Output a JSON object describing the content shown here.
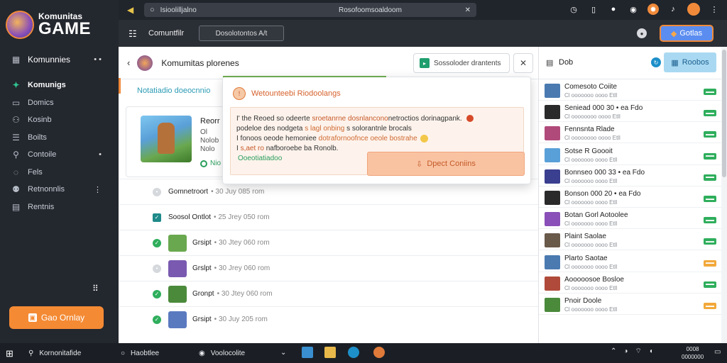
{
  "sidebar": {
    "logo_small": "Komunitas",
    "logo_big": "GAME",
    "main_item": "Komunnies",
    "items": [
      {
        "label": "Komunigs",
        "icon": "gamepad-icon"
      },
      {
        "label": "Domics",
        "icon": "chat-icon"
      },
      {
        "label": "Kosinb",
        "icon": "group-icon"
      },
      {
        "label": "Boilts",
        "icon": "list-icon"
      },
      {
        "label": "Contoile",
        "icon": "search-icon"
      },
      {
        "label": "Fels",
        "icon": "chat-icon"
      },
      {
        "label": "Retnonnlis",
        "icon": "users-icon"
      },
      {
        "label": "Rentnis",
        "icon": "building-icon"
      }
    ],
    "cta_label": "Gao Ornlay"
  },
  "topbar": {
    "url_left": "Isioolilljalno",
    "url_mid": "Rosofoomsoaldoom",
    "pin": "✕"
  },
  "toolbar": {
    "title": "Comuntfilr",
    "box_label": "Dosolotontos A/t",
    "button_label": "Gotlas"
  },
  "main": {
    "header_title": "Komumitas plorenes",
    "filter_label": "Sossoloder drantents",
    "section_title": "Notatiadio doeocnnio",
    "card": {
      "title": "Reorr",
      "line1": "Ol",
      "line2": "Nolob",
      "line3": "Nolo",
      "status": "Nio"
    },
    "rows": [
      {
        "name": "Gomnetroort",
        "meta": "• 30 Juy 085 rom",
        "check": "grey",
        "thumb": null
      },
      {
        "name": "Soosol Ontlot",
        "meta": "• 25 Jrey 050 rom",
        "check": "box",
        "thumb": null
      },
      {
        "name": "Grsipt",
        "meta": "• 30 Jtey 060 rom",
        "check": "green",
        "thumb": "#6aa84f"
      },
      {
        "name": "Grslpt",
        "meta": "• 30 Jrey 060 rom",
        "check": "grey",
        "thumb": "#7a5ab0"
      },
      {
        "name": "Gronpt",
        "meta": "• 30 Jtey 060 rom",
        "check": "green",
        "thumb": "#4a8a3a"
      },
      {
        "name": "Grsipt",
        "meta": "• 30 Juy 205 rom",
        "check": "green",
        "thumb": "#5a7ac0"
      }
    ]
  },
  "modal": {
    "title": "Wetounteebi Riodoolangs",
    "line1_a": "I' the Reoed so odeerte ",
    "line1_b": "sroetanrne dosnlancono",
    "line1_c": "netroctios dorinagpank.",
    "line2_a": "podeloe des nodgeta ",
    "line2_b": "s lagl onbing",
    "line2_c": " s solorantnle brocals",
    "line3_a": "I fonoos oeode hemoniee ",
    "line3_b": "dotrafornoofnce oeole bostrahe",
    "line4_a": "I ",
    "line4_b": "s,aet ro",
    "line4_c": " nafboroebe ba Ronolb.",
    "link": "Ooeotiatiadoo",
    "button": "Dpect Coniins"
  },
  "rpanel": {
    "title": "Dob",
    "button": "Roobos",
    "rows": [
      {
        "t1": "Comesoto Coiite",
        "t2": "Cl ooooooo oooo Etll",
        "badge": "green",
        "thumb": "#4a7ab0"
      },
      {
        "t1": "Seniead 000 30 • ea Fdo",
        "t2": "Cl oooooooo oooo Etll",
        "badge": "green",
        "thumb": "#2a2a2a"
      },
      {
        "t1": "Fennsnta Rlade",
        "t2": "Cl oooooooo oooo Etll",
        "badge": "green",
        "thumb": "#b04a7a"
      },
      {
        "t1": "Sotse R Goooit",
        "t2": "Cl ooooooo oooo Etll",
        "badge": "green",
        "thumb": "#5aa0d8"
      },
      {
        "t1": "Bonnseo 000 33 • ea Fdo",
        "t2": "Cl ooooooo oooo Etll",
        "badge": "green",
        "thumb": "#3a3f8f"
      },
      {
        "t1": "Bonson 000 20 • ea Fdo",
        "t2": "Cl ooooooo oooo Etll",
        "badge": "green",
        "thumb": "#2a2a2a"
      },
      {
        "t1": "Botan Gorl Aotoolee",
        "t2": "Cl ooooooo oooo Etll",
        "badge": "green",
        "thumb": "#8a4fb8"
      },
      {
        "t1": "Plaint Saolae",
        "t2": "Cl ooooooo oooo Etll",
        "badge": "green",
        "thumb": "#6a5a4a"
      },
      {
        "t1": "Plarto Saotae",
        "t2": "Cl ooooooo oooo Etll",
        "badge": "orange",
        "thumb": "#4a7ab0"
      },
      {
        "t1": "Aooooosoe Bosloe",
        "t2": "Cl ooooooo oooo Etll",
        "badge": "green",
        "thumb": "#b04a3a"
      },
      {
        "t1": "Pnoir Doole",
        "t2": "Cl ooooooo oooo Etll",
        "badge": "orange",
        "thumb": "#4a8a3a"
      }
    ]
  },
  "taskbar": {
    "search": "Kornonitafide",
    "app1": "Haobtlee",
    "app2": "Voolocolite",
    "time": "0008",
    "date": "0000000"
  }
}
